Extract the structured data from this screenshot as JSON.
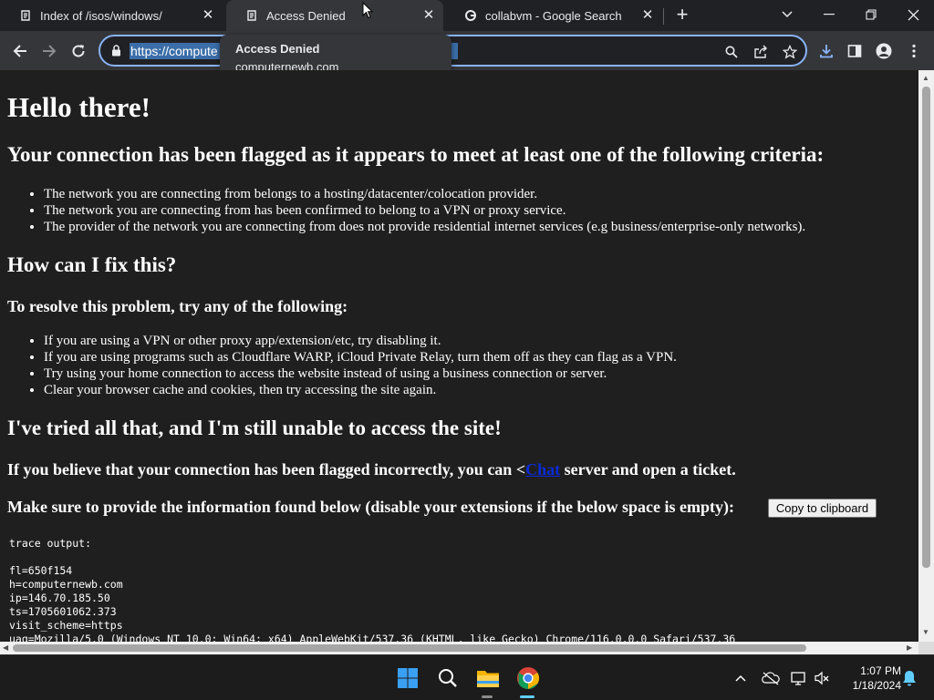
{
  "browser": {
    "tabs": [
      {
        "title": "Index of /isos/windows/",
        "close": "✕"
      },
      {
        "title": "Access Denied",
        "close": "✕"
      },
      {
        "title": "collabvm - Google Search",
        "close": "✕"
      }
    ],
    "new_tab": "+",
    "address": "https://compute",
    "hovercard": {
      "title": "Access Denied",
      "domain": "computernewb.com"
    }
  },
  "page": {
    "h1": "Hello there!",
    "h2_flagged": "Your connection has been flagged as it appears to meet at least one of the following criteria:",
    "criteria": [
      "The network you are connecting from belongs to a hosting/datacenter/colocation provider.",
      "The network you are connecting from has been confirmed to belong to a VPN or proxy service.",
      "The provider of the network you are connecting from does not provide residential internet services (e.g business/enterprise-only networks)."
    ],
    "h2_fix": "How can I fix this?",
    "h3_resolve": "To resolve this problem, try any of the following:",
    "fixes": [
      "If you are using a VPN or other proxy app/extension/etc, try disabling it.",
      "If you are using programs such as Cloudflare WARP, iCloud Private Relay, turn them off as they can flag as a VPN.",
      "Try using your home connection to access the website instead of using a business connection or server.",
      "Clear your browser cache and cookies, then try accessing the site again."
    ],
    "h2_still": "I've tried all that, and I'm still unable to access the site!",
    "believe_prefix": "If you believe that your connection has been flagged incorrectly, you can <",
    "believe_link": "Chat",
    "believe_suffix": " server and open a ticket.",
    "make_sure": "Make sure to provide the information found below (disable your extensions if the below space is empty):",
    "copy_button": "Copy to clipboard",
    "trace_header": "trace output:",
    "trace": "fl=650f154\nh=computernewb.com\nip=146.70.185.50\nts=1705601062.373\nvisit_scheme=https\nuag=Mozilla/5.0 (Windows NT 10.0; Win64; x64) AppleWebKit/537.36 (KHTML, like Gecko) Chrome/116.0.0.0 Safari/537.36"
  },
  "taskbar": {
    "time": "1:07 PM",
    "date": "1/18/2024"
  },
  "colors": {
    "accent": "#8ab4f8",
    "page_bg": "#1f1f1f",
    "link": "#0b2bd8"
  }
}
